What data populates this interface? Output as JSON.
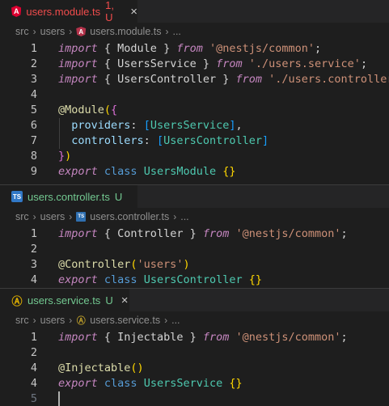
{
  "panes": [
    {
      "tab": {
        "name": "users.module.ts",
        "status": "1, U",
        "name_color": "#f14c4c",
        "status_color": "#f14c4c",
        "icon": "angular-icon",
        "close": "×"
      },
      "breadcrumb": [
        "src",
        "users",
        "users.module.ts",
        "..."
      ],
      "lines": [
        {
          "n": "1",
          "tokens": [
            [
              "kw",
              "import"
            ],
            [
              "pl",
              " { "
            ],
            [
              "pl",
              "Module"
            ],
            [
              "pl",
              " } "
            ],
            [
              "kw",
              "from"
            ],
            [
              "pl",
              " "
            ],
            [
              "str",
              "'@nestjs/common'"
            ],
            [
              "pl",
              ";"
            ]
          ]
        },
        {
          "n": "2",
          "tokens": [
            [
              "kw",
              "import"
            ],
            [
              "pl",
              " { "
            ],
            [
              "pl",
              "UsersService"
            ],
            [
              "pl",
              " } "
            ],
            [
              "kw",
              "from"
            ],
            [
              "pl",
              " "
            ],
            [
              "str",
              "'./users.service'"
            ],
            [
              "pl",
              ";"
            ]
          ]
        },
        {
          "n": "3",
          "tokens": [
            [
              "kw",
              "import"
            ],
            [
              "pl",
              " { "
            ],
            [
              "pl",
              "UsersController"
            ],
            [
              "pl",
              " } "
            ],
            [
              "kw",
              "from"
            ],
            [
              "pl",
              " "
            ],
            [
              "str",
              "'./users.controller'"
            ],
            [
              "pl",
              ";"
            ]
          ]
        },
        {
          "n": "4",
          "tokens": []
        },
        {
          "n": "5",
          "tokens": [
            [
              "dec",
              "@Module"
            ],
            [
              "br1",
              "("
            ],
            [
              "br2",
              "{"
            ]
          ]
        },
        {
          "n": "6",
          "tokens": [
            [
              "pl",
              "  "
            ],
            [
              "prop",
              "providers"
            ],
            [
              "pl",
              ": "
            ],
            [
              "br3",
              "["
            ],
            [
              "cls",
              "UsersService"
            ],
            [
              "br3",
              "]"
            ],
            [
              "pl",
              ","
            ]
          ]
        },
        {
          "n": "7",
          "tokens": [
            [
              "pl",
              "  "
            ],
            [
              "prop",
              "controllers"
            ],
            [
              "pl",
              ": "
            ],
            [
              "br3",
              "["
            ],
            [
              "cls",
              "UsersController"
            ],
            [
              "br3",
              "]"
            ]
          ]
        },
        {
          "n": "8",
          "tokens": [
            [
              "br2",
              "}"
            ],
            [
              "br1",
              ")"
            ]
          ]
        },
        {
          "n": "9",
          "tokens": [
            [
              "kw",
              "export"
            ],
            [
              "pl",
              " "
            ],
            [
              "kwb",
              "class"
            ],
            [
              "pl",
              " "
            ],
            [
              "cls",
              "UsersModule"
            ],
            [
              "pl",
              " "
            ],
            [
              "br1",
              "{}"
            ]
          ]
        }
      ]
    },
    {
      "tab": {
        "name": "users.controller.ts",
        "status": "U",
        "name_color": "#73c991",
        "status_color": "#73c991",
        "icon": "typescript-icon",
        "close": ""
      },
      "breadcrumb": [
        "src",
        "users",
        "users.controller.ts",
        "..."
      ],
      "lines": [
        {
          "n": "1",
          "tokens": [
            [
              "kw",
              "import"
            ],
            [
              "pl",
              " { "
            ],
            [
              "pl",
              "Controller"
            ],
            [
              "pl",
              " } "
            ],
            [
              "kw",
              "from"
            ],
            [
              "pl",
              " "
            ],
            [
              "str",
              "'@nestjs/common'"
            ],
            [
              "pl",
              ";"
            ]
          ]
        },
        {
          "n": "2",
          "tokens": []
        },
        {
          "n": "3",
          "tokens": [
            [
              "dec",
              "@Controller"
            ],
            [
              "br1",
              "("
            ],
            [
              "str",
              "'users'"
            ],
            [
              "br1",
              ")"
            ]
          ]
        },
        {
          "n": "4",
          "tokens": [
            [
              "kw",
              "export"
            ],
            [
              "pl",
              " "
            ],
            [
              "kwb",
              "class"
            ],
            [
              "pl",
              " "
            ],
            [
              "cls",
              "UsersController"
            ],
            [
              "pl",
              " "
            ],
            [
              "br1",
              "{}"
            ]
          ]
        }
      ]
    },
    {
      "tab": {
        "name": "users.service.ts",
        "status": "U",
        "name_color": "#73c991",
        "status_color": "#73c991",
        "icon": "angular-outline-icon",
        "close": "×"
      },
      "breadcrumb": [
        "src",
        "users",
        "users.service.ts",
        "..."
      ],
      "lines": [
        {
          "n": "1",
          "tokens": [
            [
              "kw",
              "import"
            ],
            [
              "pl",
              " { "
            ],
            [
              "pl",
              "Injectable"
            ],
            [
              "pl",
              " } "
            ],
            [
              "kw",
              "from"
            ],
            [
              "pl",
              " "
            ],
            [
              "str",
              "'@nestjs/common'"
            ],
            [
              "pl",
              ";"
            ]
          ]
        },
        {
          "n": "2",
          "tokens": []
        },
        {
          "n": "4",
          "tokens": [
            [
              "dec",
              "@Injectable"
            ],
            [
              "br1",
              "()"
            ]
          ]
        },
        {
          "n": "4",
          "tokens": [
            [
              "kw",
              "export"
            ],
            [
              "pl",
              " "
            ],
            [
              "kwb",
              "class"
            ],
            [
              "pl",
              " "
            ],
            [
              "cls",
              "UsersService"
            ],
            [
              "pl",
              " "
            ],
            [
              "br1",
              "{}"
            ]
          ]
        },
        {
          "n": "5",
          "tokens": []
        }
      ]
    }
  ]
}
